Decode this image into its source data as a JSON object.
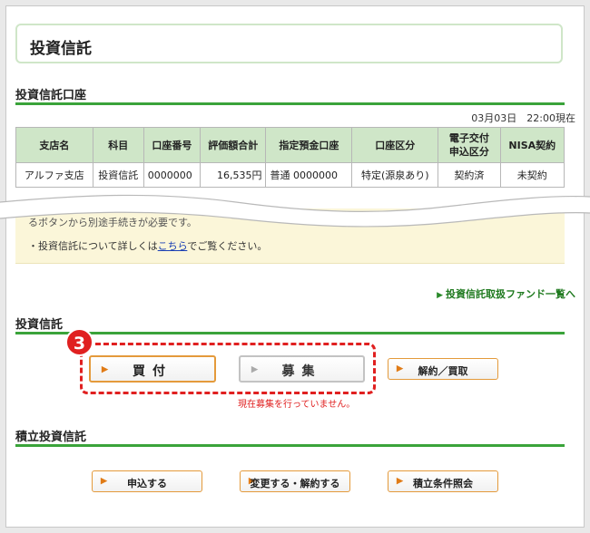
{
  "page_title": "投資信託",
  "account_section": {
    "heading": "投資信託口座",
    "timestamp": "03月03日　22:00現在",
    "columns": [
      "支店名",
      "科目",
      "口座番号",
      "評価額合計",
      "指定預金口座",
      "口座区分",
      "電子交付\n申込区分",
      "NISA契約"
    ],
    "row": [
      "アルファ支店",
      "投資信託",
      "0000000",
      "16,535円",
      "普通 0000000",
      "特定(源泉あり)",
      "契約済",
      "未契約"
    ]
  },
  "notice": {
    "line1_partial": "るボタンから別途手続きが必要です。",
    "line2_prefix": "・投資信託について詳しくは",
    "line2_link": "こちら",
    "line2_suffix": "でご覧ください。"
  },
  "fund_list_link": "投資信託取扱ファンド一覧へ",
  "trust_section": {
    "heading": "投資信託",
    "buy_label": "買付",
    "recruit_label": "募集",
    "cancel_label": "解約／買取",
    "recruit_note": "現在募集を行っていません。",
    "step_number": "3"
  },
  "accumulation_section": {
    "heading": "積立投資信託",
    "apply_label": "申込する",
    "change_label": "変更する・解約する",
    "inquiry_label": "積立条件照会"
  },
  "colors": {
    "accent_green": "#3aa33a",
    "header_green": "#cfe6c8",
    "button_orange": "#e49a3b",
    "highlight_red": "#e02020",
    "notice_yellow": "#fbf6d9"
  }
}
